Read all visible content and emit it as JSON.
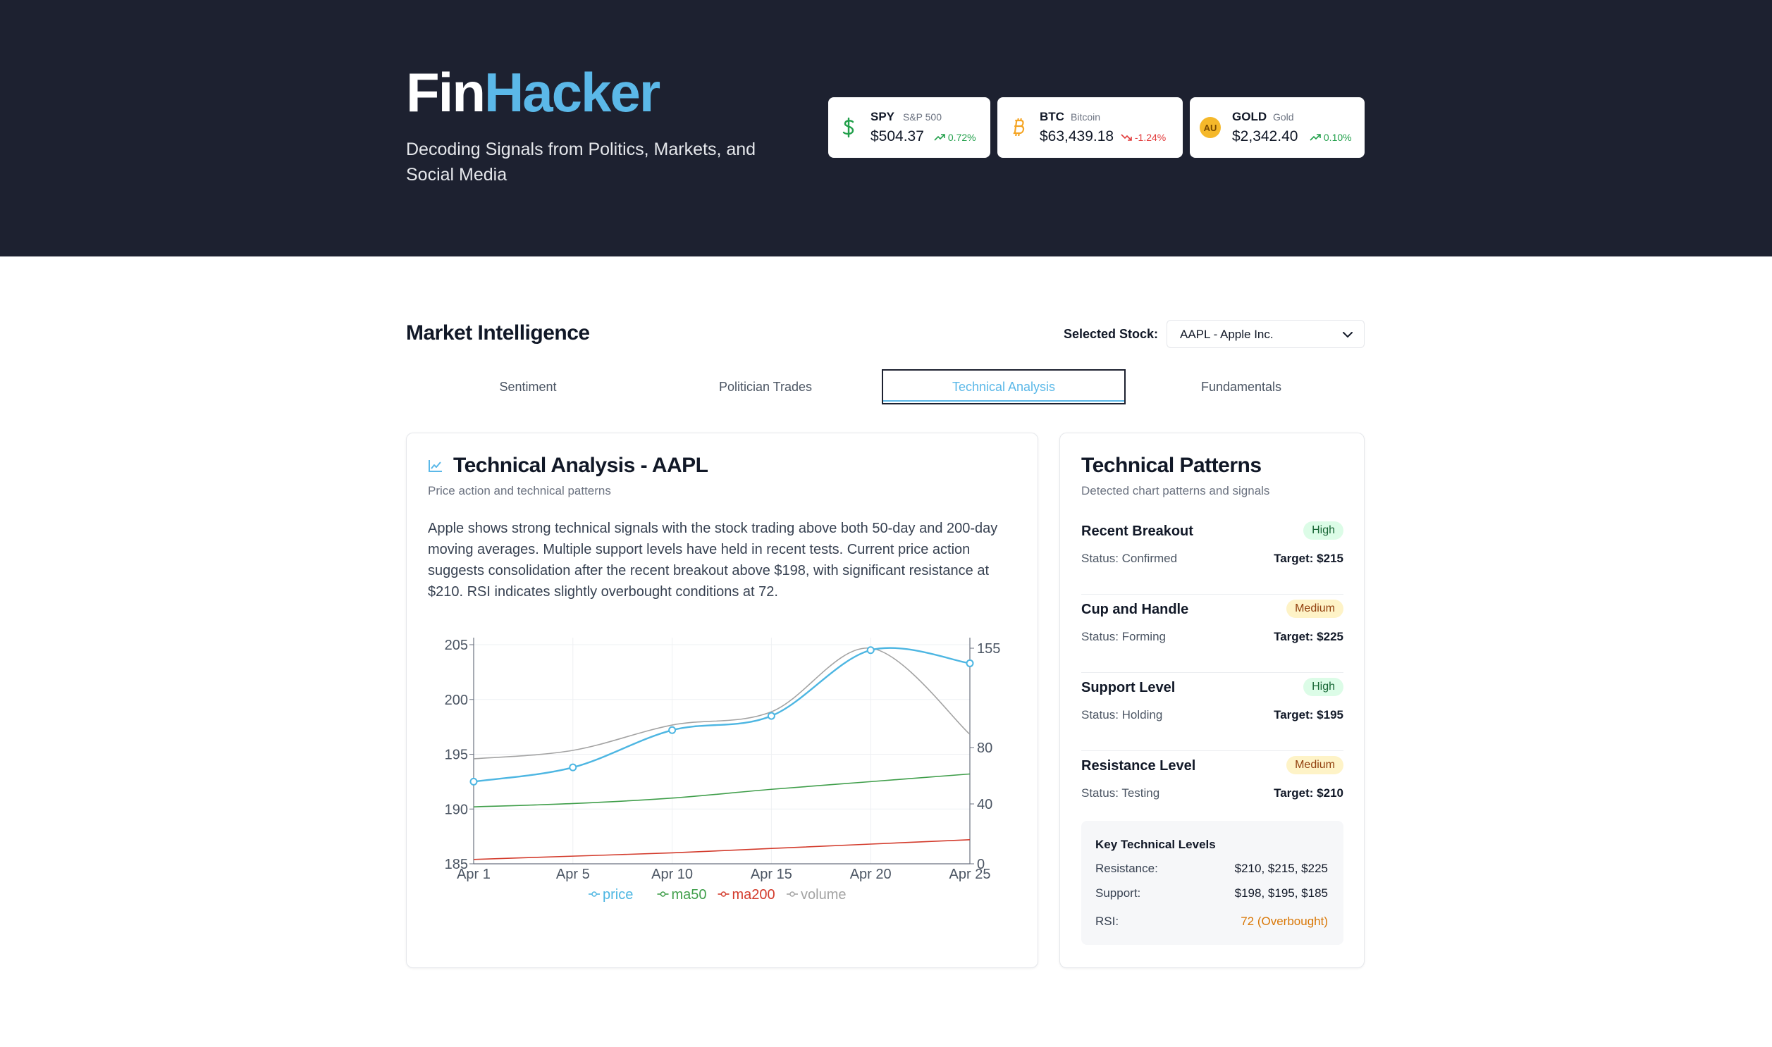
{
  "brand": {
    "part1": "Fin",
    "part2": "Hacker"
  },
  "tagline": "Decoding Signals from Politics, Markets, and Social Media",
  "tickers": [
    {
      "symbol": "SPY",
      "name": "S&P 500",
      "price": "$504.37",
      "change": "0.72%",
      "direction": "up",
      "icon": "dollar-icon"
    },
    {
      "symbol": "BTC",
      "name": "Bitcoin",
      "price": "$63,439.18",
      "change": "-1.24%",
      "direction": "down",
      "icon": "bitcoin-icon"
    },
    {
      "symbol": "GOLD",
      "name": "Gold",
      "price": "$2,342.40",
      "change": "0.10%",
      "direction": "up",
      "icon": "gold-au-icon",
      "icon_text": "AU"
    }
  ],
  "section": {
    "title": "Market Intelligence",
    "select_label": "Selected Stock:",
    "selected_stock": "AAPL - Apple Inc."
  },
  "tabs": [
    "Sentiment",
    "Politician Trades",
    "Technical Analysis",
    "Fundamentals"
  ],
  "active_tab": "Technical Analysis",
  "technical": {
    "title": "Technical Analysis - AAPL",
    "subtitle": "Price action and technical patterns",
    "summary": "Apple shows strong technical signals with the stock trading above both 50-day and 200-day moving averages. Multiple support levels have held in recent tests. Current price action suggests consolidation after the recent breakout above $198, with significant resistance at $210. RSI indicates slightly overbought conditions at 72."
  },
  "chart_data": {
    "type": "line",
    "categories": [
      "Apr 1",
      "Apr 5",
      "Apr 10",
      "Apr 15",
      "Apr 20",
      "Apr 25"
    ],
    "series": [
      {
        "name": "price",
        "axis": "left",
        "color": "#4db6e2",
        "markers": true,
        "values": [
          192.5,
          193.8,
          197.2,
          198.5,
          204.5,
          203.3
        ]
      },
      {
        "name": "ma50",
        "axis": "left",
        "color": "#3f9e4a",
        "markers": false,
        "values": [
          190.2,
          190.5,
          191.0,
          191.8,
          192.5,
          193.2
        ]
      },
      {
        "name": "ma200",
        "axis": "left",
        "color": "#d33b2c",
        "markers": false,
        "values": [
          185.4,
          185.7,
          186.0,
          186.4,
          186.8,
          187.2
        ]
      },
      {
        "name": "volume",
        "axis": "right",
        "color": "#a3a3a3",
        "markers": false,
        "values": [
          72,
          78,
          97,
          107,
          155,
          90
        ]
      }
    ],
    "y_left": {
      "min": 185,
      "max": 205,
      "ticks": [
        185,
        190,
        195,
        200,
        205
      ]
    },
    "y_right": {
      "ticks": [
        0,
        40,
        80,
        155
      ]
    },
    "grid": true,
    "legend": "bottom-center"
  },
  "patterns": {
    "title": "Technical Patterns",
    "subtitle": "Detected chart patterns and signals",
    "items": [
      {
        "name": "Recent Breakout",
        "confidence": "High",
        "status": "Status: Confirmed",
        "target": "Target: $215"
      },
      {
        "name": "Cup and Handle",
        "confidence": "Medium",
        "status": "Status: Forming",
        "target": "Target: $225"
      },
      {
        "name": "Support Level",
        "confidence": "High",
        "status": "Status: Holding",
        "target": "Target: $195"
      },
      {
        "name": "Resistance Level",
        "confidence": "Medium",
        "status": "Status: Testing",
        "target": "Target: $210"
      }
    ],
    "levels": {
      "title": "Key Technical Levels",
      "resistance_label": "Resistance:",
      "resistance": "$210, $215, $225",
      "support_label": "Support:",
      "support": "$198, $195, $185",
      "rsi_label": "RSI:",
      "rsi": "72 (Overbought)"
    }
  },
  "colors": {
    "header_bg": "#1d2130",
    "accent": "#5bb8e8",
    "up": "#22a04b",
    "down": "#e23b3b"
  }
}
